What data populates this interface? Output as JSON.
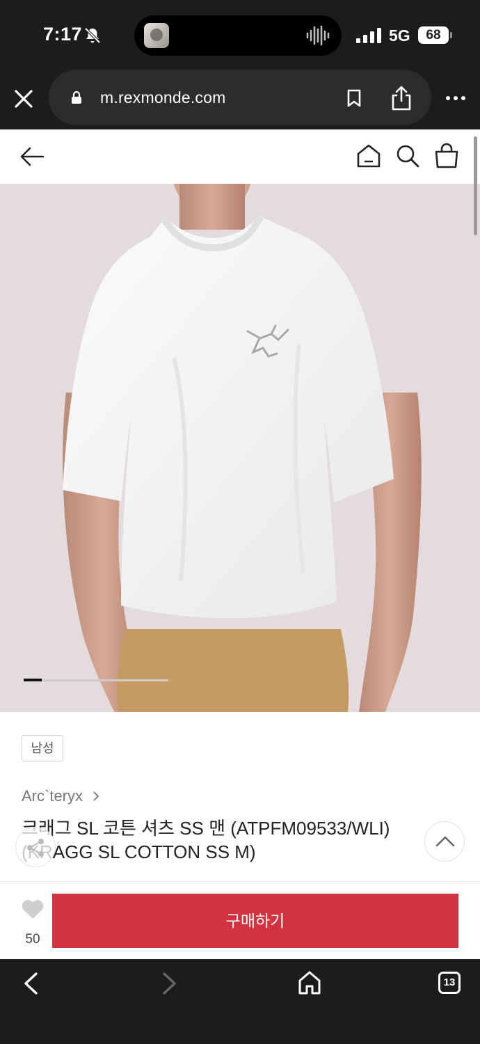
{
  "status_bar": {
    "time": "7:17",
    "network": "5G",
    "battery": "68"
  },
  "browser": {
    "url": "m.rexmonde.com"
  },
  "product": {
    "gender_tag": "남성",
    "brand": "Arc`teryx",
    "title": "크래그 SL 코튼 셔츠 SS 맨 (ATPFM09533/WLI) (KRAGG SL COTTON SS M)",
    "like_count": "50",
    "buy_label": "구매하기",
    "image_slide_index": 1,
    "image_slide_total": 8
  },
  "toolbar": {
    "tab_count": "13"
  },
  "colors": {
    "buy_button": "#d1343f",
    "chrome_bg": "#1c1c1e",
    "image_bg": "#e4dcdc"
  },
  "icons": [
    "bell-slash-icon",
    "close-icon",
    "lock-icon",
    "bookmark-icon",
    "share-icon",
    "more-icon",
    "back-arrow-icon",
    "home-icon",
    "search-icon",
    "shopping-bag-icon",
    "chevron-right-icon",
    "heart-icon",
    "chevron-up-icon",
    "chevron-left-icon",
    "tabs-icon"
  ]
}
